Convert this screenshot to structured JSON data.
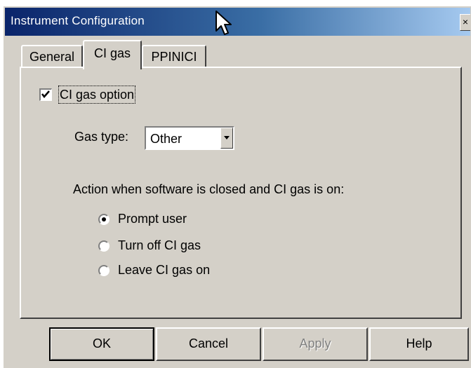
{
  "window": {
    "title": "Instrument Configuration",
    "close_symbol": "×"
  },
  "tabs": [
    {
      "label": "General",
      "selected": false
    },
    {
      "label": "CI gas",
      "selected": true
    },
    {
      "label": "PPINICI",
      "selected": false
    }
  ],
  "ci_gas": {
    "option_label": "CI gas option",
    "option_checked": true,
    "gas_type_label": "Gas type:",
    "gas_type_value": "Other",
    "action_label": "Action when software is closed and CI gas is on:",
    "actions": [
      {
        "label": "Prompt user",
        "selected": true
      },
      {
        "label": "Turn off CI gas",
        "selected": false
      },
      {
        "label": "Leave CI gas on",
        "selected": false
      }
    ]
  },
  "buttons": {
    "ok": "OK",
    "cancel": "Cancel",
    "apply": "Apply",
    "help": "Help"
  },
  "colors": {
    "titlebar_start": "#0a246a",
    "titlebar_end": "#a6caf0",
    "face": "#d4d0c8"
  },
  "icons": [
    "close-icon",
    "mouse-cursor-icon",
    "checkmark-icon",
    "dropdown-arrow-icon"
  ]
}
